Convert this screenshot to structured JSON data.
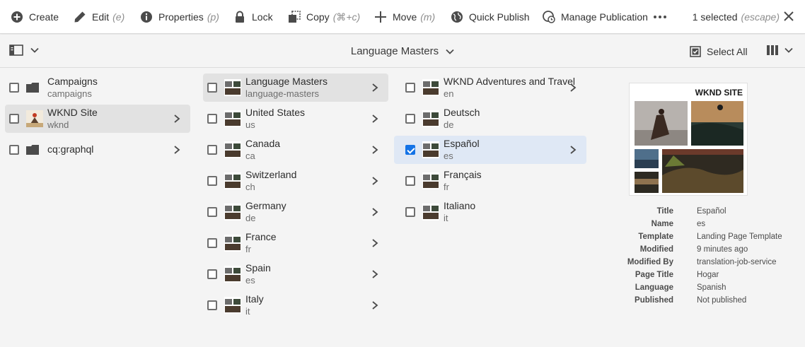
{
  "toolbar": {
    "create": "Create",
    "edit": "Edit",
    "edit_shortcut": "(e)",
    "properties": "Properties",
    "properties_shortcut": "(p)",
    "lock": "Lock",
    "copy": "Copy",
    "copy_shortcut": "(⌘+c)",
    "move": "Move",
    "move_shortcut": "(m)",
    "quick_publish": "Quick Publish",
    "manage_publication": "Manage Publication",
    "selection_text": "1 selected",
    "selection_escape": "(escape)"
  },
  "subheader": {
    "title": "Language Masters",
    "select_all": "Select All"
  },
  "column1": [
    {
      "title": "Campaigns",
      "name": "campaigns"
    },
    {
      "title": "WKND Site",
      "name": "wknd"
    },
    {
      "title": "cq:graphql",
      "name": ""
    }
  ],
  "column2": [
    {
      "title": "Language Masters",
      "name": "language-masters"
    },
    {
      "title": "United States",
      "name": "us"
    },
    {
      "title": "Canada",
      "name": "ca"
    },
    {
      "title": "Switzerland",
      "name": "ch"
    },
    {
      "title": "Germany",
      "name": "de"
    },
    {
      "title": "France",
      "name": "fr"
    },
    {
      "title": "Spain",
      "name": "es"
    },
    {
      "title": "Italy",
      "name": "it"
    }
  ],
  "column3": [
    {
      "title": "WKND Adventures and Travel",
      "name": "en"
    },
    {
      "title": "Deutsch",
      "name": "de"
    },
    {
      "title": "Español",
      "name": "es"
    },
    {
      "title": "Français",
      "name": "fr"
    },
    {
      "title": "Italiano",
      "name": "it"
    }
  ],
  "preview": {
    "logo_text": "WKND SITE",
    "meta": [
      {
        "key": "Title",
        "value": "Español"
      },
      {
        "key": "Name",
        "value": "es"
      },
      {
        "key": "Template",
        "value": "Landing Page Template"
      },
      {
        "key": "Modified",
        "value": "9 minutes ago"
      },
      {
        "key": "Modified By",
        "value": "translation-job-service"
      },
      {
        "key": "Page Title",
        "value": "Hogar"
      },
      {
        "key": "Language",
        "value": "Spanish"
      },
      {
        "key": "Published",
        "value": "Not published"
      }
    ]
  },
  "colors": {
    "accent": "#1473e6",
    "selected_row": "#e2e2e2",
    "checked_row": "#dfe8f5"
  }
}
